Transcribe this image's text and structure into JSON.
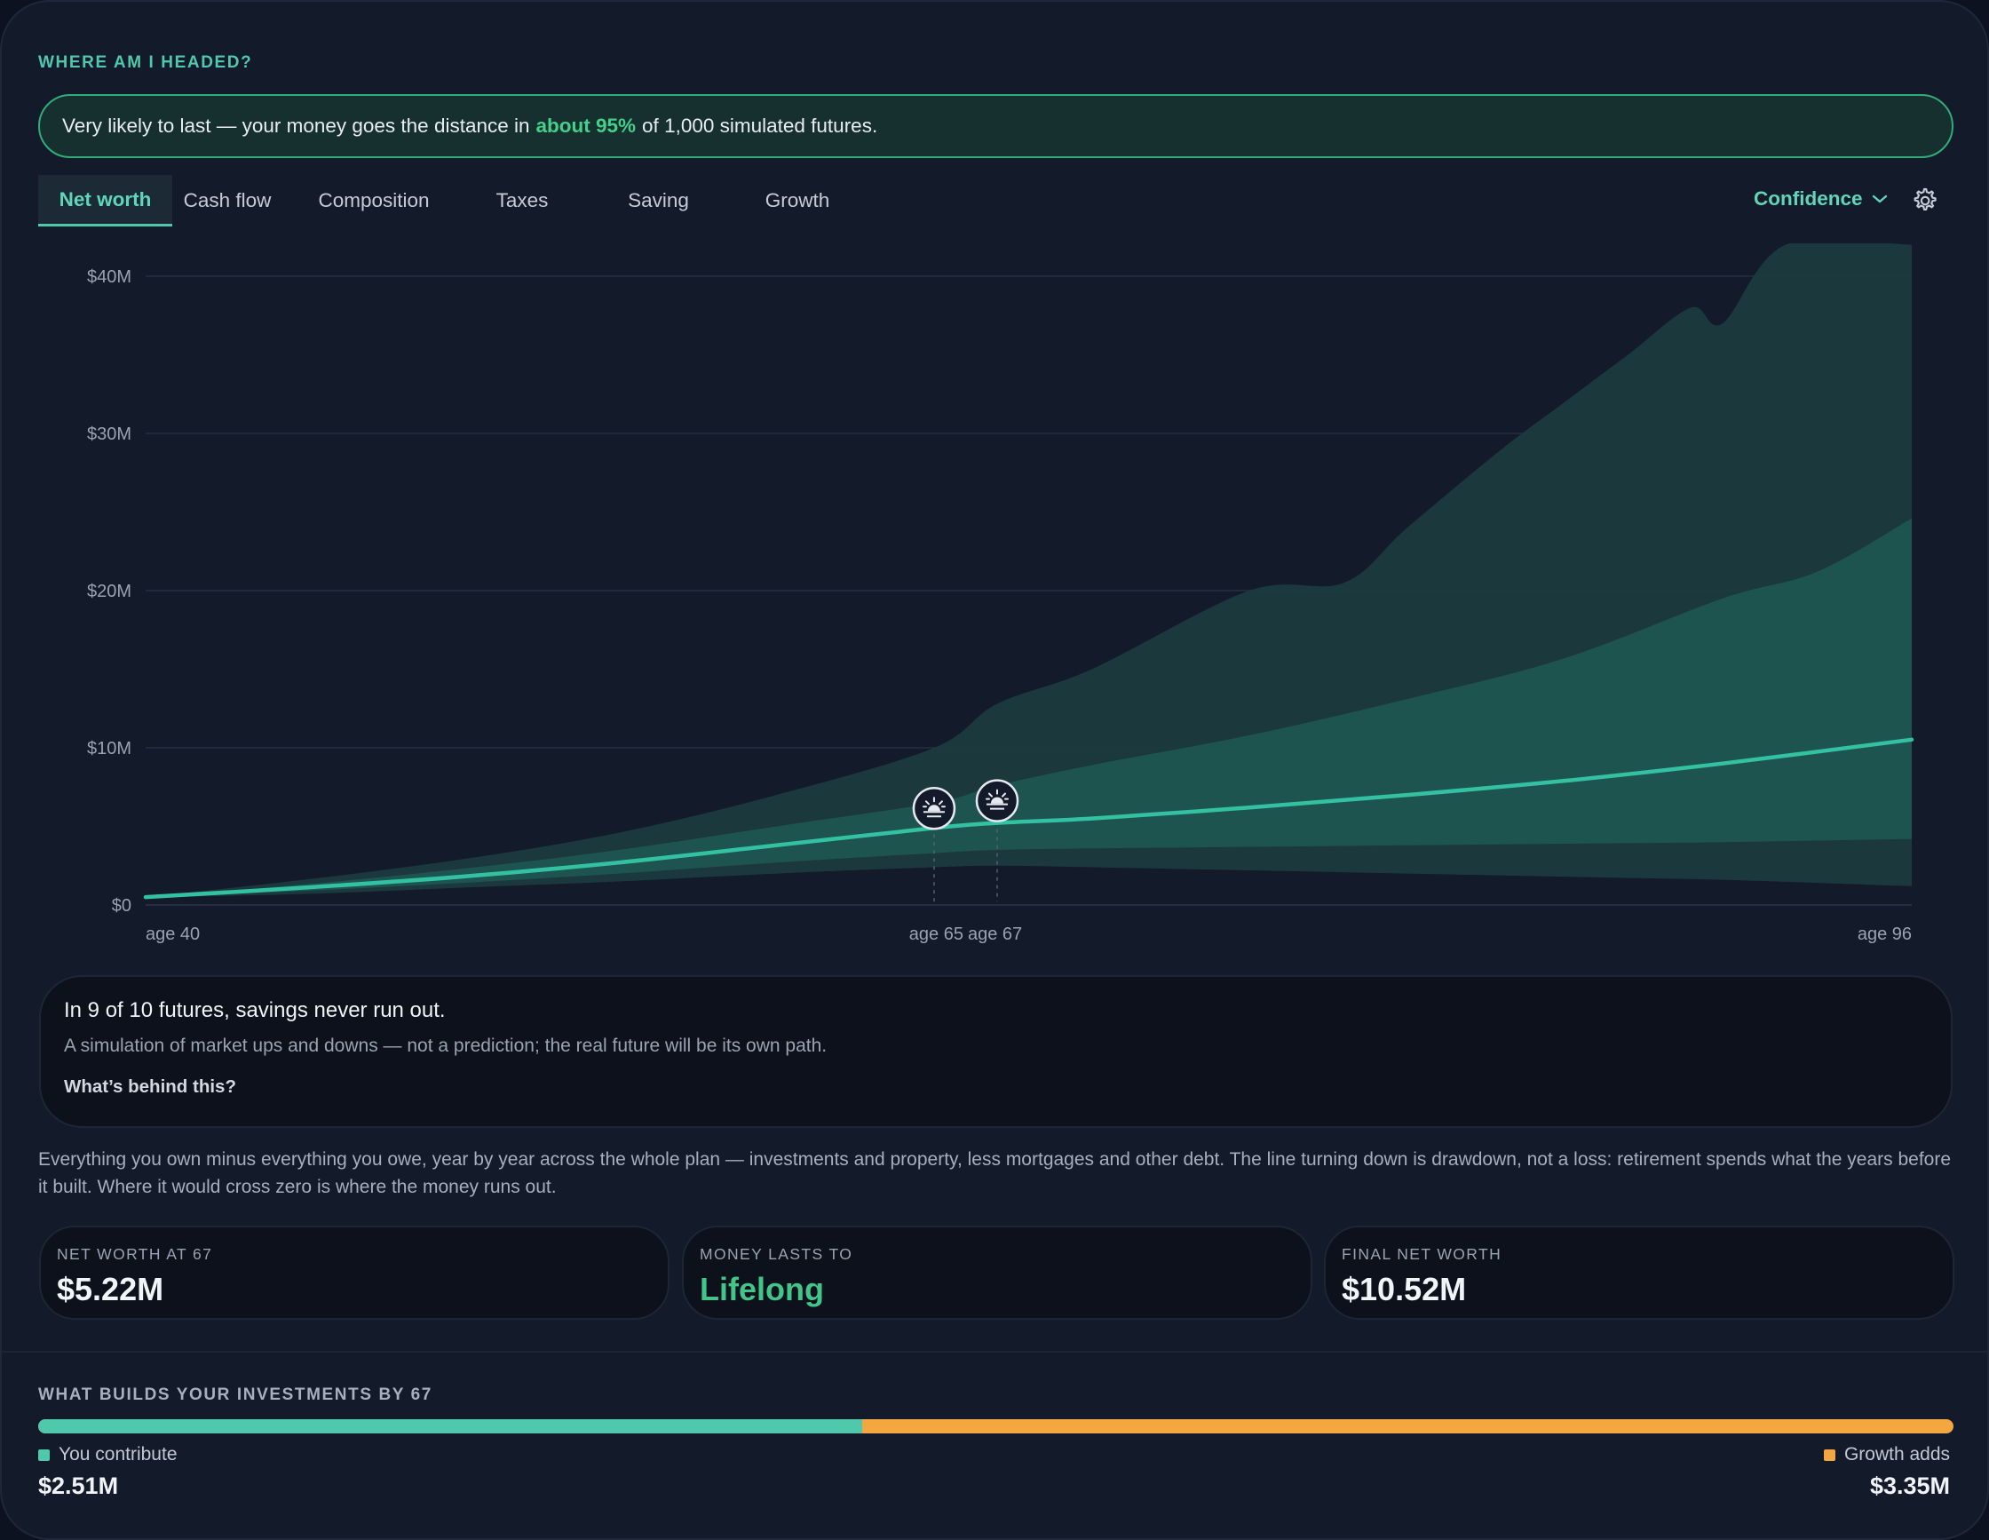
{
  "header": {
    "title": "WHERE AM I HEADED?"
  },
  "banner": {
    "pre": "Very likely to last — your money goes the distance in",
    "highlight": "about 95%",
    "post": "of 1,000 simulated futures."
  },
  "tabs": [
    {
      "label": "Net worth",
      "active": true
    },
    {
      "label": "Cash flow"
    },
    {
      "label": "Composition"
    },
    {
      "label": "Taxes"
    },
    {
      "label": "Saving"
    },
    {
      "label": "Growth"
    }
  ],
  "controls": {
    "confidence_label": "Confidence",
    "settings_icon": "gear-icon",
    "dropdown_icon": "chevron-down-icon"
  },
  "chart_data": {
    "type": "area",
    "yticks": [
      "$40M",
      "$30M",
      "$20M",
      "$10M",
      "$0"
    ],
    "ylim": [
      0,
      40
    ],
    "y_unit": "$M",
    "xlim": [
      40,
      96
    ],
    "x_labels": [
      "age 40",
      "age 65",
      "age 67",
      "age 96"
    ],
    "markers": [
      {
        "age": 65,
        "icon": "sunset-icon"
      },
      {
        "age": 67,
        "icon": "sunset-icon"
      }
    ],
    "series": [
      {
        "role": "median",
        "x": [
          40,
          45,
          50,
          55,
          60,
          65,
          67,
          70,
          75,
          80,
          85,
          90,
          96
        ],
        "y": [
          0.5,
          1.1,
          1.8,
          2.7,
          3.8,
          4.9,
          5.22,
          5.5,
          6.2,
          7.0,
          7.9,
          9.0,
          10.52
        ]
      },
      {
        "role": "inner-band-upper",
        "x": [
          40,
          45,
          50,
          55,
          60,
          65,
          67,
          70,
          75,
          80,
          85,
          90,
          93,
          96
        ],
        "y": [
          0.5,
          1.3,
          2.3,
          3.5,
          5.0,
          6.5,
          7.6,
          8.9,
          10.8,
          13.1,
          15.7,
          19.5,
          21.2,
          24.6
        ]
      },
      {
        "role": "inner-band-lower",
        "x": [
          40,
          45,
          50,
          55,
          60,
          65,
          67,
          70,
          75,
          80,
          85,
          90,
          96
        ],
        "y": [
          0.5,
          0.9,
          1.4,
          2.0,
          2.7,
          3.3,
          3.5,
          3.6,
          3.7,
          3.8,
          3.9,
          4.0,
          4.2
        ]
      },
      {
        "role": "outer-band-upper",
        "x": [
          40,
          45,
          50,
          55,
          60,
          65,
          67,
          70,
          75,
          78,
          80,
          83,
          85,
          87,
          89,
          90,
          92,
          96
        ],
        "y": [
          0.5,
          1.6,
          2.9,
          4.6,
          7.0,
          10.0,
          12.8,
          15.0,
          20.0,
          20.5,
          24.0,
          29.0,
          32.0,
          35.0,
          38.0,
          37.0,
          42.0,
          42.0
        ]
      },
      {
        "role": "outer-band-lower",
        "x": [
          40,
          45,
          50,
          55,
          60,
          65,
          67,
          70,
          75,
          80,
          85,
          90,
          96
        ],
        "y": [
          0.5,
          0.7,
          1.1,
          1.5,
          2.0,
          2.4,
          2.5,
          2.4,
          2.2,
          2.0,
          1.8,
          1.6,
          1.2
        ]
      }
    ]
  },
  "note": {
    "title": "In 9 of 10 futures, savings never run out.",
    "subtitle": "A simulation of market ups and downs — not a prediction; the real future will be its own path.",
    "link": "What’s behind this?"
  },
  "description": "Everything you own minus everything you owe, year by year across the whole plan — investments and property, less mortgages and other debt. The line turning down is drawdown, not a loss: retirement spends what the years before it built. Where it would cross zero is where the money runs out.",
  "stats": [
    {
      "label": "NET WORTH AT 67",
      "value": "$5.22M"
    },
    {
      "label": "MONEY LASTS TO",
      "value": "Lifelong"
    },
    {
      "label": "FINAL NET WORTH",
      "value": "$10.52M"
    }
  ],
  "build": {
    "title": "WHAT BUILDS YOUR INVESTMENTS BY 67",
    "contribute_label": "You contribute",
    "contribute_value": "$2.51M",
    "contribute_fraction": 0.43,
    "growth_label": "Growth adds",
    "growth_value": "$3.35M",
    "colors": {
      "contribute": "#4fc8ac",
      "growth": "#f4a640"
    }
  }
}
